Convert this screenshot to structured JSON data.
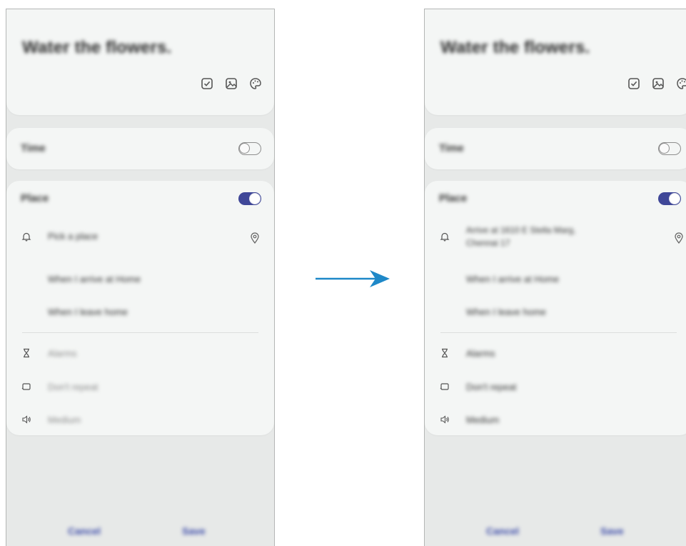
{
  "note": {
    "title": "Water the flowers.",
    "icons": [
      "checkbox-icon",
      "image-icon",
      "palette-icon"
    ]
  },
  "time": {
    "label": "Time",
    "toggle_on": false
  },
  "place": {
    "label": "Place",
    "toggle_on": true,
    "pick_place": "Pick a place",
    "address_line1": "Arrive at 1610 E Stella Marg,",
    "address_line2": "Chennai 17",
    "options": [
      "When I arrive at Home",
      "When I leave home"
    ]
  },
  "settings": {
    "alarm": "Alarms",
    "repeat": "Don't repeat",
    "volume": "Medium"
  },
  "footer": {
    "cancel": "Cancel",
    "save": "Save"
  },
  "colors": {
    "accent": "#3f4798",
    "arrow": "#1e88c8",
    "button_text": "#3b4aa8"
  }
}
